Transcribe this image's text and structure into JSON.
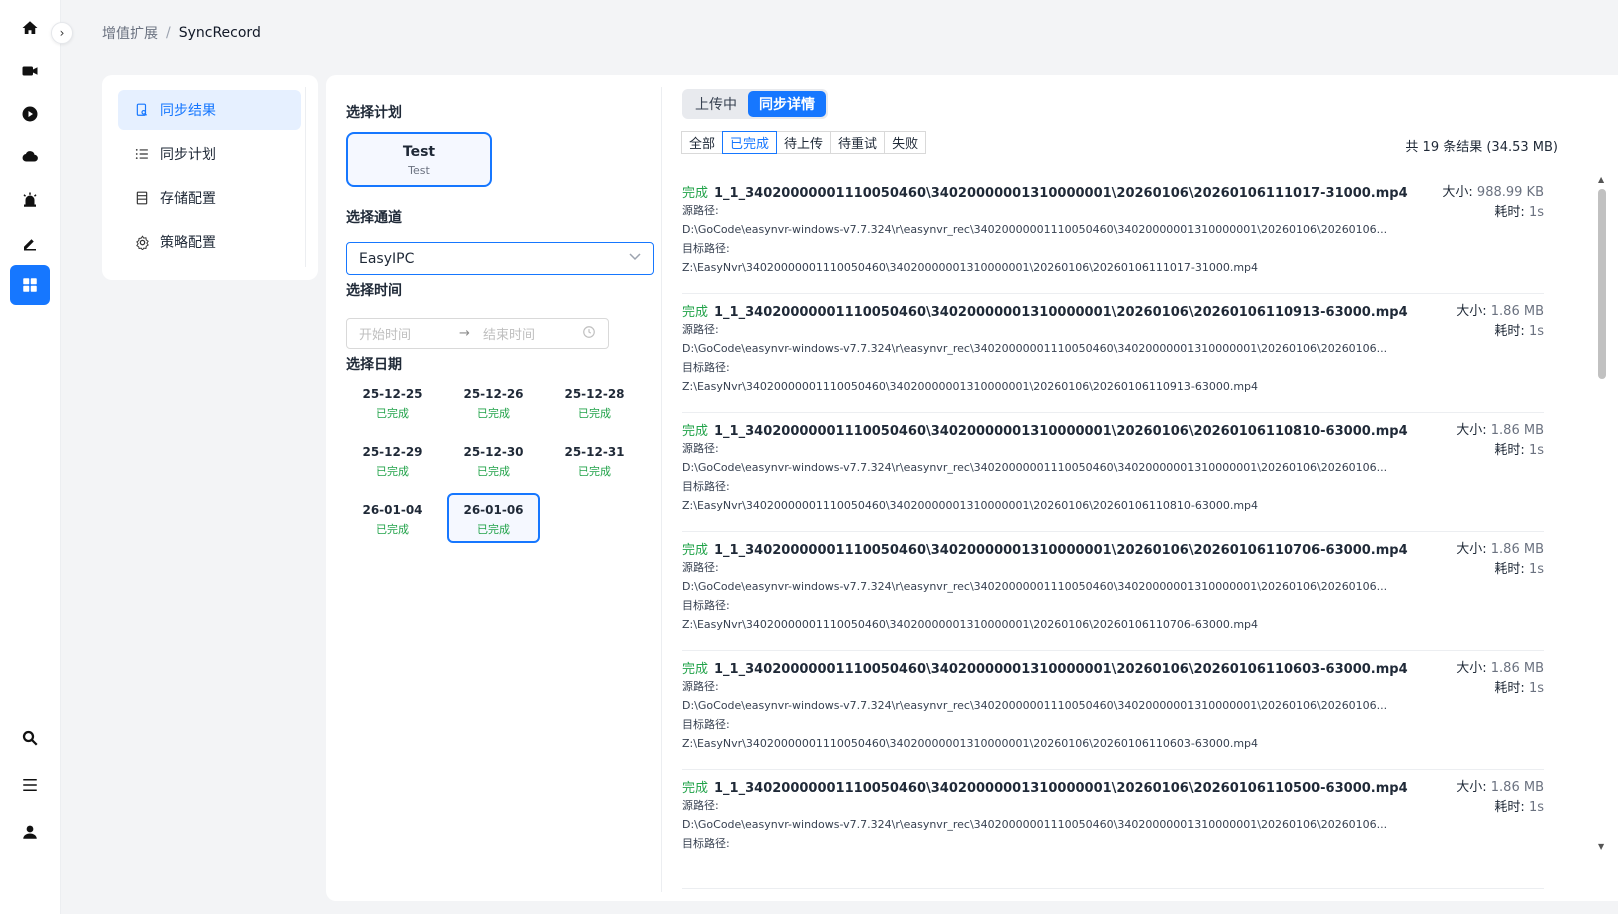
{
  "breadcrumb": {
    "parent": "增值扩展",
    "current": "SyncRecord"
  },
  "rail": {
    "icons": [
      "home-icon",
      "video-icon",
      "play-icon",
      "cloud-icon",
      "alarm-icon",
      "edit-icon",
      "apps-icon"
    ],
    "bottom_icons": [
      "search-icon",
      "menu-icon",
      "user-icon"
    ],
    "active": "apps-icon",
    "accent": "#1677ff"
  },
  "menu": {
    "items": [
      {
        "label": "同步结果",
        "icon": "doc-search-icon",
        "active": true
      },
      {
        "label": "同步计划",
        "icon": "list-icon",
        "active": false
      },
      {
        "label": "存储配置",
        "icon": "storage-icon",
        "active": false
      },
      {
        "label": "策略配置",
        "icon": "gear-icon",
        "active": false
      }
    ]
  },
  "left": {
    "plan_label": "选择计划",
    "plan": {
      "name": "Test",
      "sub": "Test"
    },
    "channel_label": "选择通道",
    "channel_value": "EasyIPC",
    "time_label": "选择时间",
    "time_start_placeholder": "开始时间",
    "time_arrow": "→",
    "time_end_placeholder": "结束时间",
    "date_label": "选择日期",
    "dates": [
      {
        "date": "25-12-25",
        "status": "已完成"
      },
      {
        "date": "25-12-26",
        "status": "已完成"
      },
      {
        "date": "25-12-28",
        "status": "已完成"
      },
      {
        "date": "25-12-29",
        "status": "已完成"
      },
      {
        "date": "25-12-30",
        "status": "已完成"
      },
      {
        "date": "25-12-31",
        "status": "已完成"
      },
      {
        "date": "26-01-04",
        "status": "已完成"
      },
      {
        "date": "26-01-06",
        "status": "已完成",
        "active": true
      }
    ]
  },
  "right": {
    "segments": [
      {
        "label": "上传中"
      },
      {
        "label": "同步详情",
        "active": true
      }
    ],
    "filters": [
      {
        "label": "全部"
      },
      {
        "label": "已完成",
        "active": true
      },
      {
        "label": "待上传"
      },
      {
        "label": "待重试"
      },
      {
        "label": "失败"
      }
    ],
    "total": "共 19 条结果 (34.53 MB)",
    "src_label": "源路径:",
    "dst_label": "目标路径:",
    "size_label": "大小:",
    "time_label": "耗时:",
    "records": [
      {
        "status": "完成",
        "name": "1_1_34020000001110050460\\34020000001310000001\\20260106\\20260106111017-31000.mp4",
        "src": "D:\\GoCode\\easynvr-windows-v7.7.324\\r\\easynvr_rec\\34020000001110050460\\34020000001310000001\\20260106\\20260106...",
        "dst": "Z:\\EasyNvr\\34020000001110050460\\34020000001310000001\\20260106\\20260106111017-31000.mp4",
        "size": "988.99 KB",
        "duration": "1s"
      },
      {
        "status": "完成",
        "name": "1_1_34020000001110050460\\34020000001310000001\\20260106\\20260106110913-63000.mp4",
        "src": "D:\\GoCode\\easynvr-windows-v7.7.324\\r\\easynvr_rec\\34020000001110050460\\34020000001310000001\\20260106\\20260106...",
        "dst": "Z:\\EasyNvr\\34020000001110050460\\34020000001310000001\\20260106\\20260106110913-63000.mp4",
        "size": "1.86 MB",
        "duration": "1s"
      },
      {
        "status": "完成",
        "name": "1_1_34020000001110050460\\34020000001310000001\\20260106\\20260106110810-63000.mp4",
        "src": "D:\\GoCode\\easynvr-windows-v7.7.324\\r\\easynvr_rec\\34020000001110050460\\34020000001310000001\\20260106\\20260106...",
        "dst": "Z:\\EasyNvr\\34020000001110050460\\34020000001310000001\\20260106\\20260106110810-63000.mp4",
        "size": "1.86 MB",
        "duration": "1s"
      },
      {
        "status": "完成",
        "name": "1_1_34020000001110050460\\34020000001310000001\\20260106\\20260106110706-63000.mp4",
        "src": "D:\\GoCode\\easynvr-windows-v7.7.324\\r\\easynvr_rec\\34020000001110050460\\34020000001310000001\\20260106\\20260106...",
        "dst": "Z:\\EasyNvr\\34020000001110050460\\34020000001310000001\\20260106\\20260106110706-63000.mp4",
        "size": "1.86 MB",
        "duration": "1s"
      },
      {
        "status": "完成",
        "name": "1_1_34020000001110050460\\34020000001310000001\\20260106\\20260106110603-63000.mp4",
        "src": "D:\\GoCode\\easynvr-windows-v7.7.324\\r\\easynvr_rec\\34020000001110050460\\34020000001310000001\\20260106\\20260106...",
        "dst": "Z:\\EasyNvr\\34020000001110050460\\34020000001310000001\\20260106\\20260106110603-63000.mp4",
        "size": "1.86 MB",
        "duration": "1s"
      },
      {
        "status": "完成",
        "name": "1_1_34020000001110050460\\34020000001310000001\\20260106\\20260106110500-63000.mp4",
        "src": "D:\\GoCode\\easynvr-windows-v7.7.324\\r\\easynvr_rec\\34020000001110050460\\34020000001310000001\\20260106\\20260106...",
        "dst": "",
        "size": "1.86 MB",
        "duration": "1s"
      }
    ]
  }
}
